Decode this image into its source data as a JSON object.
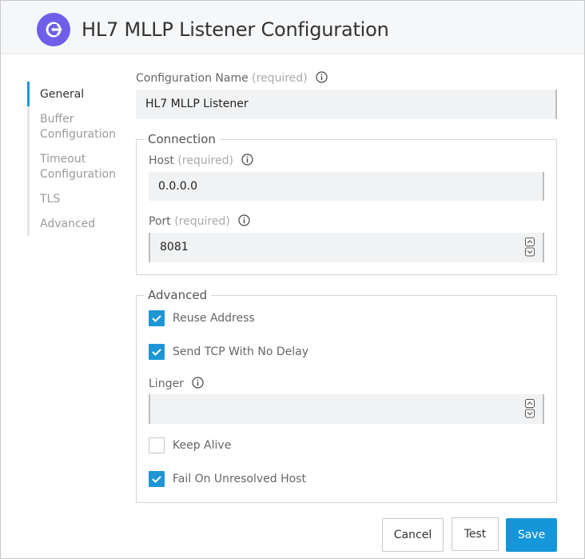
{
  "header": {
    "title": "HL7 MLLP Listener Configuration",
    "icon": "power-plug-icon",
    "icon_color": "#6f5ee8"
  },
  "nav": {
    "items": [
      {
        "label": "General",
        "active": true
      },
      {
        "label": "Buffer\nConfiguration",
        "active": false
      },
      {
        "label": "Timeout\nConfiguration",
        "active": false
      },
      {
        "label": "TLS",
        "active": false
      },
      {
        "label": "Advanced",
        "active": false
      }
    ],
    "accent": "#1e96d6"
  },
  "config_name": {
    "label": "Configuration Name",
    "required": "(required)",
    "value": "HL7 MLLP Listener"
  },
  "connection": {
    "legend": "Connection",
    "host": {
      "label": "Host",
      "required": "(required)",
      "value": "0.0.0.0"
    },
    "port": {
      "label": "Port",
      "required": "(required)",
      "value": "8081"
    }
  },
  "advanced": {
    "legend": "Advanced",
    "reuse_address": {
      "label": "Reuse Address",
      "checked": true
    },
    "tcp_no_delay": {
      "label": "Send TCP With No Delay",
      "checked": true
    },
    "linger": {
      "label": "Linger",
      "value": ""
    },
    "keep_alive": {
      "label": "Keep Alive",
      "checked": false
    },
    "fail_unresolved": {
      "label": "Fail On Unresolved Host",
      "checked": true
    }
  },
  "buttons": {
    "cancel": "Cancel",
    "test": "Test",
    "save": "Save"
  },
  "colors": {
    "primary": "#1496d8",
    "field_bg": "#f1f2f3"
  }
}
